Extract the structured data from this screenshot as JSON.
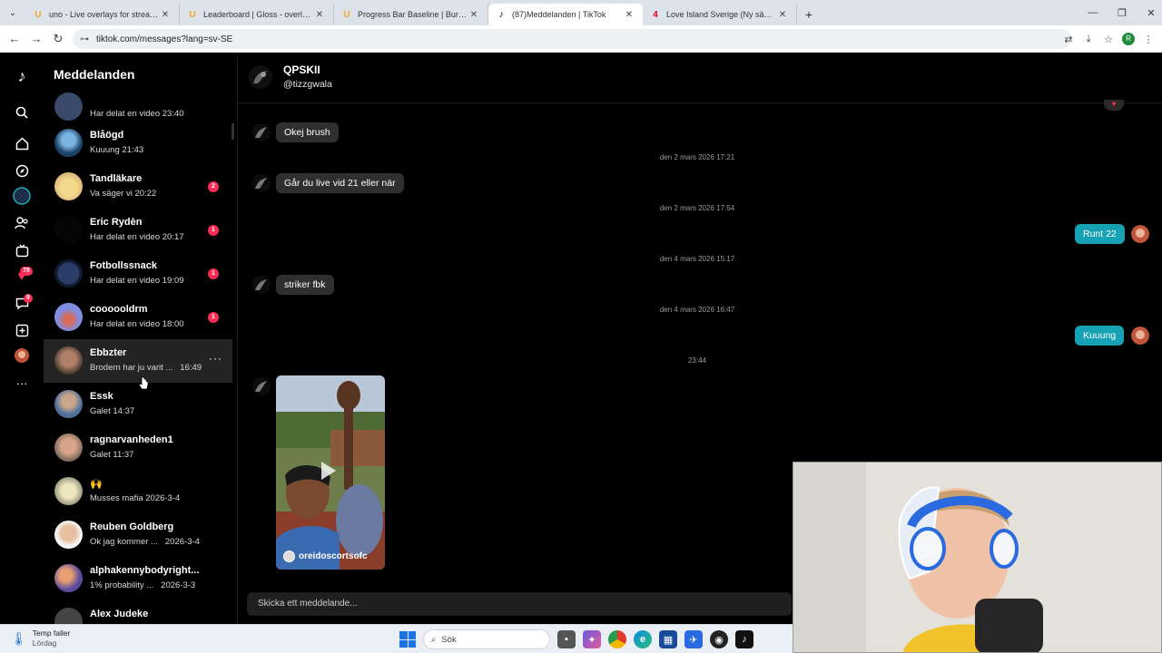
{
  "browser": {
    "tabs": [
      {
        "title": "uno - Live overlays for streamin",
        "icon": "uno-favicon",
        "color": "#f5a623",
        "glyph": "U"
      },
      {
        "title": "Leaderboard | Gloss - overlays",
        "icon": "uno-favicon",
        "color": "#f5a623",
        "glyph": "U"
      },
      {
        "title": "Progress Bar Baseline | Burst - U",
        "icon": "uno-favicon",
        "color": "#f5a623",
        "glyph": "U"
      },
      {
        "title": "(87)Meddelanden | TikTok",
        "icon": "tiktok-favicon",
        "color": "#000000",
        "glyph": "♪"
      },
      {
        "title": "Love Island Sverige (Ny säsong",
        "icon": "tv4-favicon",
        "color": "#e4002b",
        "glyph": "4"
      }
    ],
    "url": "tiktok.com/messages?lang=sv-SE",
    "profile_initial": "R"
  },
  "rail": {
    "badges": {
      "activity": "78",
      "messages": "9"
    }
  },
  "conversations": {
    "title": "Meddelanden",
    "items": [
      {
        "name": "",
        "preview": "Har delat en video",
        "time": "23:40",
        "unread": "",
        "avatar": "#3a4a6a"
      },
      {
        "name": "Blåögd",
        "preview": "Kuuung",
        "time": "21:43",
        "unread": "",
        "avatar": "#2a5c8a"
      },
      {
        "name": "Tandläkare",
        "preview": "Va säger vi",
        "time": "20:22",
        "unread": "2",
        "avatar": "#e8c893"
      },
      {
        "name": "Eric Rydèn",
        "preview": "Har delat en video",
        "time": "20:17",
        "unread": "1",
        "avatar": "#050505"
      },
      {
        "name": "Fotbollssnack",
        "preview": "Har delat en video",
        "time": "19:09",
        "unread": "1",
        "avatar": "#1c2a4a"
      },
      {
        "name": "coooooldrm",
        "preview": "Har delat en video",
        "time": "18:00",
        "unread": "1",
        "avatar": "#6a7ad8"
      },
      {
        "name": "Ebbzter",
        "preview": "Brodern har ju varit ...",
        "time": "16:49",
        "unread": "",
        "avatar": "#6b5040"
      },
      {
        "name": "Essk",
        "preview": "Galet",
        "time": "14:37",
        "unread": "",
        "avatar": "#5a7aa8"
      },
      {
        "name": "ragnarvanheden1",
        "preview": "Galet",
        "time": "11:37",
        "unread": "",
        "avatar": "#b88a70"
      },
      {
        "name": "🙌",
        "preview": "Musses mafia",
        "time": "2026-3-4",
        "unread": "",
        "avatar": "#d8d0b0"
      },
      {
        "name": "Reuben Goldberg",
        "preview": "Ok jag kommer ...",
        "time": "2026-3-4",
        "unread": "",
        "avatar": "#c8a080"
      },
      {
        "name": "alphakennybodyright...",
        "preview": "1% probability ...",
        "time": "2026-3-3",
        "unread": "",
        "avatar": "#8a6ab8"
      },
      {
        "name": "Alex Judeke",
        "preview": "",
        "time": "",
        "unread": "",
        "avatar": "#444444"
      }
    ]
  },
  "chat": {
    "name": "QPSKII",
    "handle": "@tizzgwala",
    "messages": [
      {
        "type": "in",
        "text": "Okej brush"
      },
      {
        "type": "time",
        "text": "den 2 mars 2026 17:21"
      },
      {
        "type": "in",
        "text": "Går du live vid 21 eller när"
      },
      {
        "type": "time",
        "text": "den 2 mars 2026 17:54"
      },
      {
        "type": "out",
        "text": "Runt 22"
      },
      {
        "type": "time",
        "text": "den 4 mars 2026 15:17"
      },
      {
        "type": "in",
        "text": "striker fbk"
      },
      {
        "type": "time",
        "text": "den 4 mars 2026 16:47"
      },
      {
        "type": "out",
        "text": "Kuuung"
      },
      {
        "type": "time",
        "text": "23:44"
      }
    ],
    "video": {
      "author": "oreidoscortsofc"
    },
    "composer_placeholder": "Skicka ett meddelande..."
  },
  "taskbar": {
    "weather_title": "Temp faller",
    "weather_day": "Lördag",
    "search_label": "Sök"
  },
  "colors": {
    "accent": "#fe2c55",
    "outgoing_bubble": "#17a1b4",
    "incoming_bubble": "#2f2f2f"
  }
}
